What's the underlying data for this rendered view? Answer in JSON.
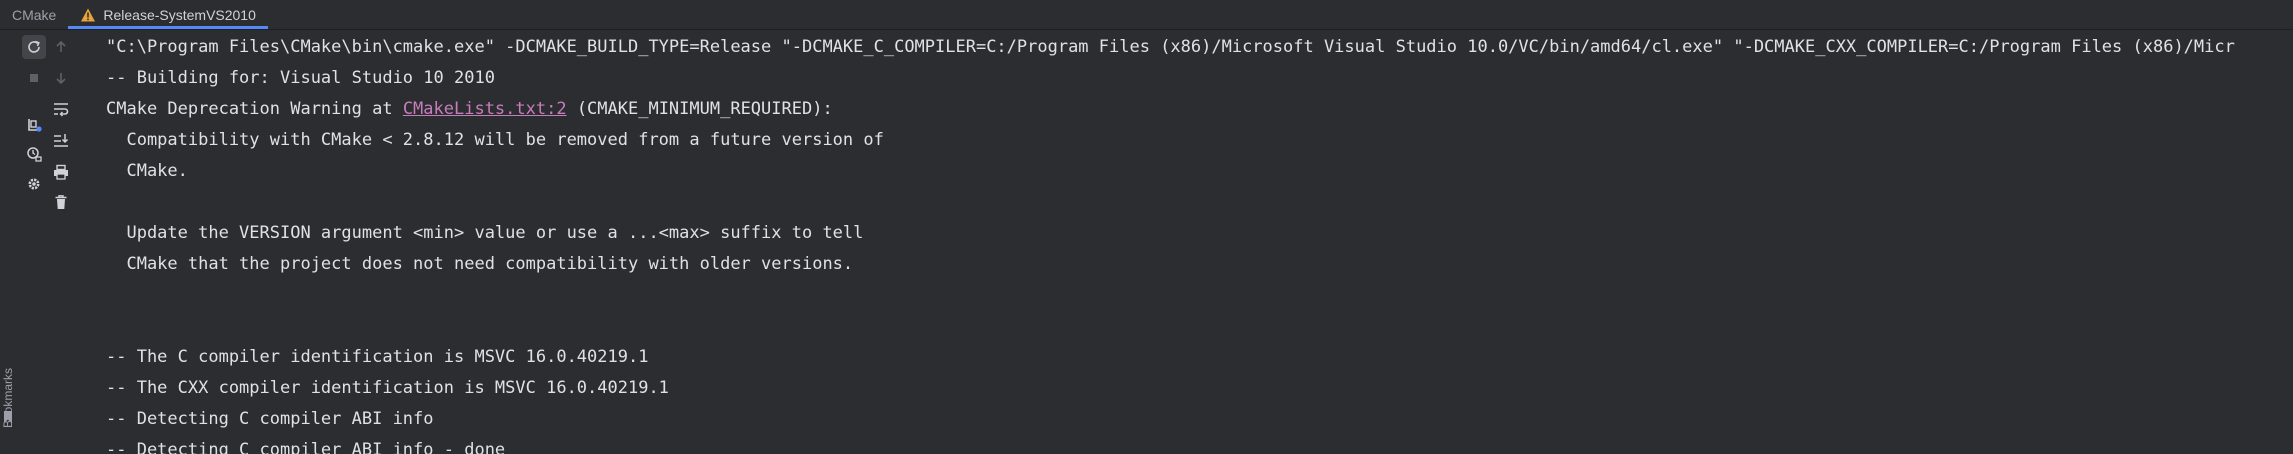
{
  "tabs": [
    {
      "label": "CMake",
      "active": false,
      "warning": false
    },
    {
      "label": "Release-SystemVS2010",
      "active": true,
      "warning": true
    }
  ],
  "side_panel": {
    "bookmarks_label": "Bookmarks"
  },
  "toolbar": {
    "icons": [
      "rerun-icon",
      "stop-icon",
      "scroll-up-icon",
      "scroll-down-icon",
      "soft-wrap-icon",
      "scroll-to-end-icon",
      "clear-cache-icon",
      "print-icon",
      "reload-icon",
      "delete-icon",
      "settings-icon"
    ]
  },
  "console": {
    "lines": [
      {
        "text": "\"C:\\Program Files\\CMake\\bin\\cmake.exe\" -DCMAKE_BUILD_TYPE=Release \"-DCMAKE_C_COMPILER=C:/Program Files (x86)/Microsoft Visual Studio 10.0/VC/bin/amd64/cl.exe\" \"-DCMAKE_CXX_COMPILER=C:/Program Files (x86)/Micr"
      },
      {
        "text": "-- Building for: Visual Studio 10 2010"
      },
      {
        "prefix": "CMake Deprecation Warning at ",
        "link": "CMakeLists.txt:2",
        "suffix": " (CMAKE_MINIMUM_REQUIRED):"
      },
      {
        "text": "  Compatibility with CMake < 2.8.12 will be removed from a future version of"
      },
      {
        "text": "  CMake."
      },
      {
        "text": ""
      },
      {
        "text": "  Update the VERSION argument <min> value or use a ...<max> suffix to tell"
      },
      {
        "text": "  CMake that the project does not need compatibility with older versions."
      },
      {
        "text": ""
      },
      {
        "text": ""
      },
      {
        "text": "-- The C compiler identification is MSVC 16.0.40219.1"
      },
      {
        "text": "-- The CXX compiler identification is MSVC 16.0.40219.1"
      },
      {
        "text": "-- Detecting C compiler ABI info"
      },
      {
        "text": "-- Detecting C compiler ABI info - done"
      }
    ]
  },
  "colors": {
    "background": "#2b2d30",
    "text": "#dfe1e5",
    "link": "#c77dbb",
    "accent": "#548af7",
    "warning": "#e8a33d"
  }
}
